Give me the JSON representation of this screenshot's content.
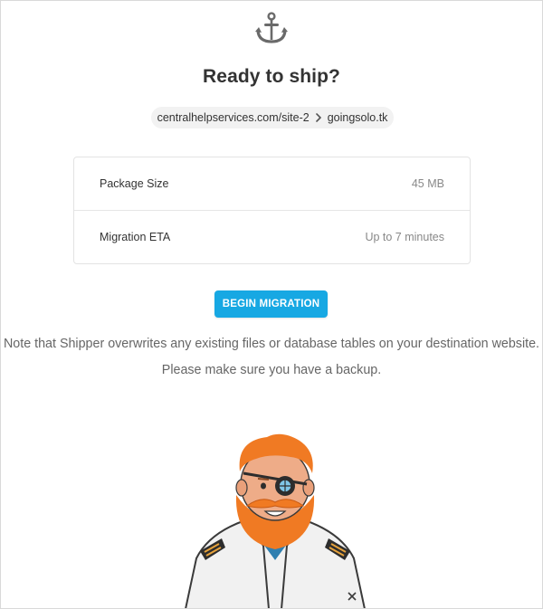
{
  "header": {
    "icon": "anchor-icon",
    "title": "Ready to ship?"
  },
  "route": {
    "source": "centralhelpservices.com/site-2",
    "destination": "goingsolo.tk"
  },
  "details": [
    {
      "label": "Package Size",
      "value": "45 MB"
    },
    {
      "label": "Migration ETA",
      "value": "Up to 7 minutes"
    }
  ],
  "actions": {
    "begin_label": "BEGIN MIGRATION"
  },
  "notes": {
    "line1": "Note that Shipper overwrites any existing files or database tables on your destination website.",
    "line2": "Please make sure you have a backup."
  },
  "colors": {
    "accent": "#17a8e3",
    "text": "#333333",
    "muted": "#888888",
    "pill": "#f2f2f2",
    "border": "#e3e3e3"
  },
  "illustration": {
    "name": "captain-mascot",
    "icon": "captain-illustration"
  }
}
